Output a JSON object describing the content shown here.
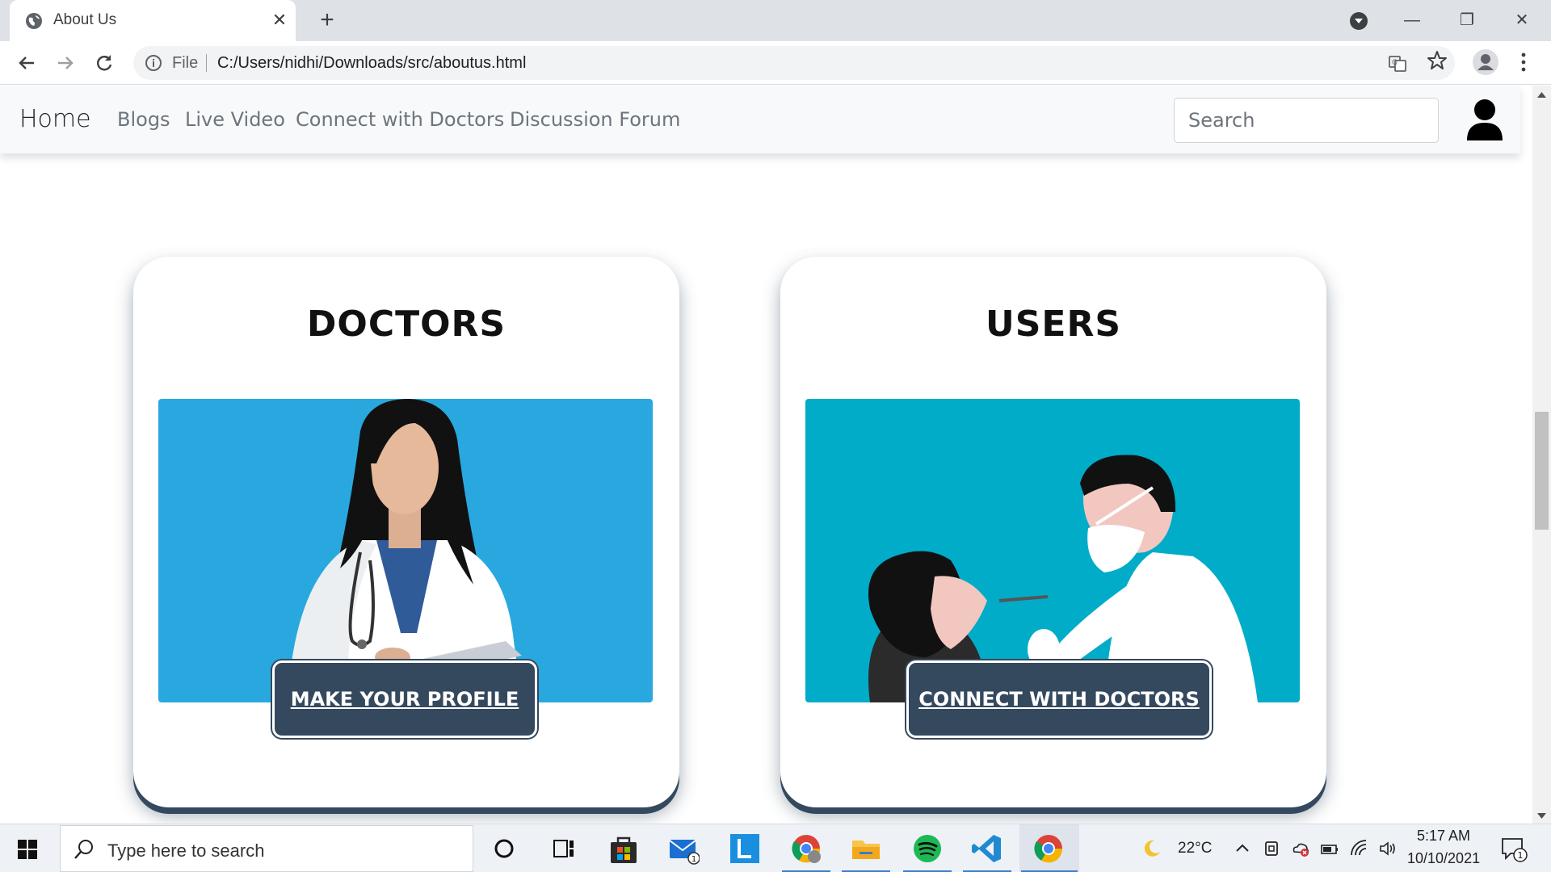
{
  "browser": {
    "tab_title": "About Us",
    "tab_close": "✕",
    "new_tab": "+",
    "address_scheme": "File",
    "address_url": "C:/Users/nidhi/Downloads/src/aboutus.html",
    "window_controls": {
      "minimize": "—",
      "restore": "❐",
      "close": "✕"
    }
  },
  "navbar": {
    "brand": "Home",
    "links": [
      "Blogs",
      "Live Video",
      "Connect with Doctors",
      "Discussion Forum"
    ],
    "search_placeholder": "Search"
  },
  "cards": [
    {
      "title": "DOCTORS",
      "button": "MAKE YOUR PROFILE",
      "image_bg": "#29a8e0"
    },
    {
      "title": "USERS",
      "button": "CONNECT WITH DOCTORS",
      "image_bg": "#00acc8"
    }
  ],
  "colors": {
    "button_bg": "#34495e",
    "navbar_bg": "#f8f9fa"
  },
  "taskbar": {
    "search_placeholder": "Type here to search",
    "weather": "22°C",
    "time": "5:17 AM",
    "date": "10/10/2021",
    "mail_badge": "1",
    "notification_badge": "1",
    "apps": [
      "cortana-icon",
      "task-view-icon",
      "store-icon",
      "mail-icon",
      "l-app-icon",
      "chrome-profile-icon",
      "file-explorer-icon",
      "spotify-icon",
      "vscode-icon",
      "chrome-icon"
    ]
  }
}
